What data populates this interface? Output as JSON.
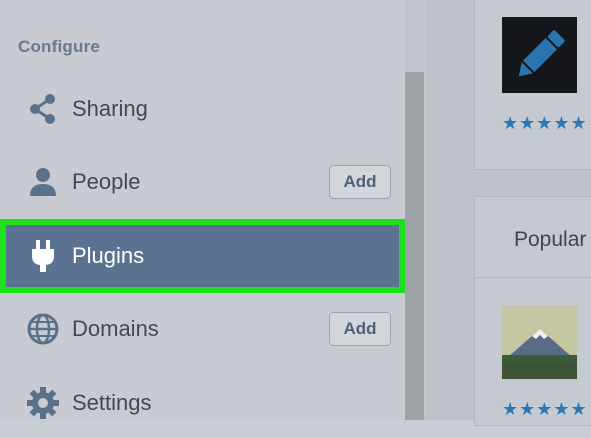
{
  "sidebar": {
    "section_title": "Configure",
    "items": [
      {
        "label": "Sharing",
        "icon": "share-icon"
      },
      {
        "label": "People",
        "icon": "person-icon",
        "action": "Add"
      },
      {
        "label": "Plugins",
        "icon": "plug-icon",
        "active": true
      },
      {
        "label": "Domains",
        "icon": "globe-icon",
        "action": "Add"
      },
      {
        "label": "Settings",
        "icon": "gear-icon"
      }
    ]
  },
  "main": {
    "top_card": {
      "icon": "pencil-icon",
      "stars": "★★★★★"
    },
    "popular_card": {
      "title": "Popular",
      "stars": "★★★★★",
      "thumb": "mountain-thumbnail"
    }
  },
  "colors": {
    "active_bg": "#5b7390",
    "highlight_border": "#1ee21e",
    "star": "#2a78b8"
  }
}
